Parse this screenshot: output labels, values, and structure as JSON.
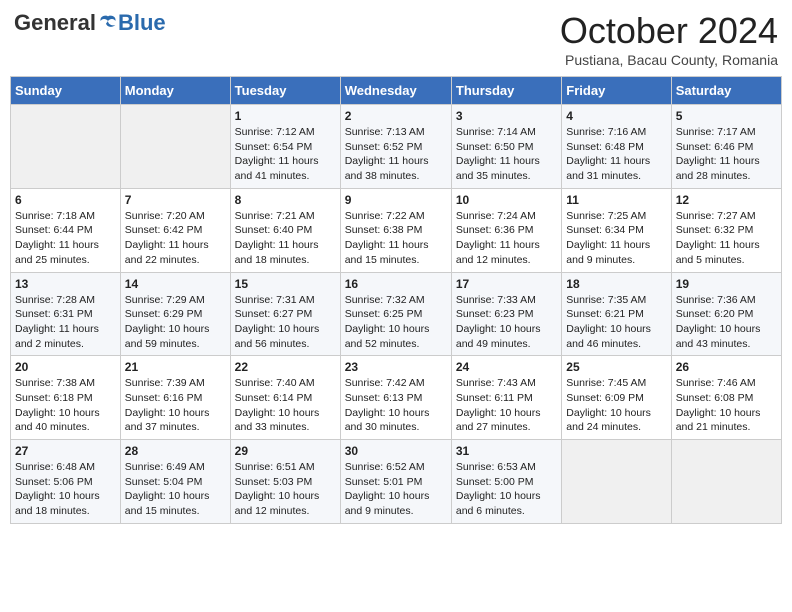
{
  "header": {
    "logo_general": "General",
    "logo_blue": "Blue",
    "month": "October 2024",
    "location": "Pustiana, Bacau County, Romania"
  },
  "weekdays": [
    "Sunday",
    "Monday",
    "Tuesday",
    "Wednesday",
    "Thursday",
    "Friday",
    "Saturday"
  ],
  "weeks": [
    [
      {
        "day": "",
        "empty": true
      },
      {
        "day": "",
        "empty": true
      },
      {
        "day": "1",
        "sunrise": "7:12 AM",
        "sunset": "6:54 PM",
        "daylight": "11 hours and 41 minutes."
      },
      {
        "day": "2",
        "sunrise": "7:13 AM",
        "sunset": "6:52 PM",
        "daylight": "11 hours and 38 minutes."
      },
      {
        "day": "3",
        "sunrise": "7:14 AM",
        "sunset": "6:50 PM",
        "daylight": "11 hours and 35 minutes."
      },
      {
        "day": "4",
        "sunrise": "7:16 AM",
        "sunset": "6:48 PM",
        "daylight": "11 hours and 31 minutes."
      },
      {
        "day": "5",
        "sunrise": "7:17 AM",
        "sunset": "6:46 PM",
        "daylight": "11 hours and 28 minutes."
      }
    ],
    [
      {
        "day": "6",
        "sunrise": "7:18 AM",
        "sunset": "6:44 PM",
        "daylight": "11 hours and 25 minutes."
      },
      {
        "day": "7",
        "sunrise": "7:20 AM",
        "sunset": "6:42 PM",
        "daylight": "11 hours and 22 minutes."
      },
      {
        "day": "8",
        "sunrise": "7:21 AM",
        "sunset": "6:40 PM",
        "daylight": "11 hours and 18 minutes."
      },
      {
        "day": "9",
        "sunrise": "7:22 AM",
        "sunset": "6:38 PM",
        "daylight": "11 hours and 15 minutes."
      },
      {
        "day": "10",
        "sunrise": "7:24 AM",
        "sunset": "6:36 PM",
        "daylight": "11 hours and 12 minutes."
      },
      {
        "day": "11",
        "sunrise": "7:25 AM",
        "sunset": "6:34 PM",
        "daylight": "11 hours and 9 minutes."
      },
      {
        "day": "12",
        "sunrise": "7:27 AM",
        "sunset": "6:32 PM",
        "daylight": "11 hours and 5 minutes."
      }
    ],
    [
      {
        "day": "13",
        "sunrise": "7:28 AM",
        "sunset": "6:31 PM",
        "daylight": "11 hours and 2 minutes."
      },
      {
        "day": "14",
        "sunrise": "7:29 AM",
        "sunset": "6:29 PM",
        "daylight": "10 hours and 59 minutes."
      },
      {
        "day": "15",
        "sunrise": "7:31 AM",
        "sunset": "6:27 PM",
        "daylight": "10 hours and 56 minutes."
      },
      {
        "day": "16",
        "sunrise": "7:32 AM",
        "sunset": "6:25 PM",
        "daylight": "10 hours and 52 minutes."
      },
      {
        "day": "17",
        "sunrise": "7:33 AM",
        "sunset": "6:23 PM",
        "daylight": "10 hours and 49 minutes."
      },
      {
        "day": "18",
        "sunrise": "7:35 AM",
        "sunset": "6:21 PM",
        "daylight": "10 hours and 46 minutes."
      },
      {
        "day": "19",
        "sunrise": "7:36 AM",
        "sunset": "6:20 PM",
        "daylight": "10 hours and 43 minutes."
      }
    ],
    [
      {
        "day": "20",
        "sunrise": "7:38 AM",
        "sunset": "6:18 PM",
        "daylight": "10 hours and 40 minutes."
      },
      {
        "day": "21",
        "sunrise": "7:39 AM",
        "sunset": "6:16 PM",
        "daylight": "10 hours and 37 minutes."
      },
      {
        "day": "22",
        "sunrise": "7:40 AM",
        "sunset": "6:14 PM",
        "daylight": "10 hours and 33 minutes."
      },
      {
        "day": "23",
        "sunrise": "7:42 AM",
        "sunset": "6:13 PM",
        "daylight": "10 hours and 30 minutes."
      },
      {
        "day": "24",
        "sunrise": "7:43 AM",
        "sunset": "6:11 PM",
        "daylight": "10 hours and 27 minutes."
      },
      {
        "day": "25",
        "sunrise": "7:45 AM",
        "sunset": "6:09 PM",
        "daylight": "10 hours and 24 minutes."
      },
      {
        "day": "26",
        "sunrise": "7:46 AM",
        "sunset": "6:08 PM",
        "daylight": "10 hours and 21 minutes."
      }
    ],
    [
      {
        "day": "27",
        "sunrise": "6:48 AM",
        "sunset": "5:06 PM",
        "daylight": "10 hours and 18 minutes."
      },
      {
        "day": "28",
        "sunrise": "6:49 AM",
        "sunset": "5:04 PM",
        "daylight": "10 hours and 15 minutes."
      },
      {
        "day": "29",
        "sunrise": "6:51 AM",
        "sunset": "5:03 PM",
        "daylight": "10 hours and 12 minutes."
      },
      {
        "day": "30",
        "sunrise": "6:52 AM",
        "sunset": "5:01 PM",
        "daylight": "10 hours and 9 minutes."
      },
      {
        "day": "31",
        "sunrise": "6:53 AM",
        "sunset": "5:00 PM",
        "daylight": "10 hours and 6 minutes."
      },
      {
        "day": "",
        "empty": true
      },
      {
        "day": "",
        "empty": true
      }
    ]
  ]
}
